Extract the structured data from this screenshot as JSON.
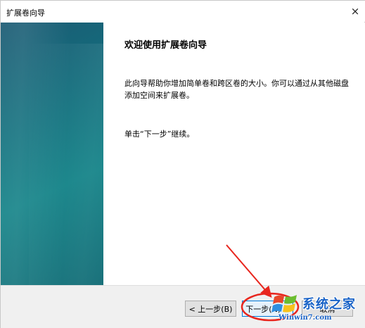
{
  "window": {
    "title": "扩展卷向导",
    "close_glyph": "×"
  },
  "content": {
    "heading": "欢迎使用扩展卷向导",
    "description": "此向导帮助你增加简单卷和跨区卷的大小。你可以通过从其他磁盘添加空间来扩展卷。",
    "hint": "单击“下一步”继续。"
  },
  "buttons": {
    "back": "< 上一步(B)",
    "next": "下一步(N) >",
    "cancel": "取消"
  },
  "watermark": {
    "name": "系统之家",
    "url": "Winwin7.com"
  },
  "colors": {
    "side_panel": "#13727f",
    "annotation": "#e8261e",
    "watermark": "#1a63c7"
  },
  "icons": {
    "close": "close-icon",
    "watermark_logo": "windows-logo-icon"
  }
}
